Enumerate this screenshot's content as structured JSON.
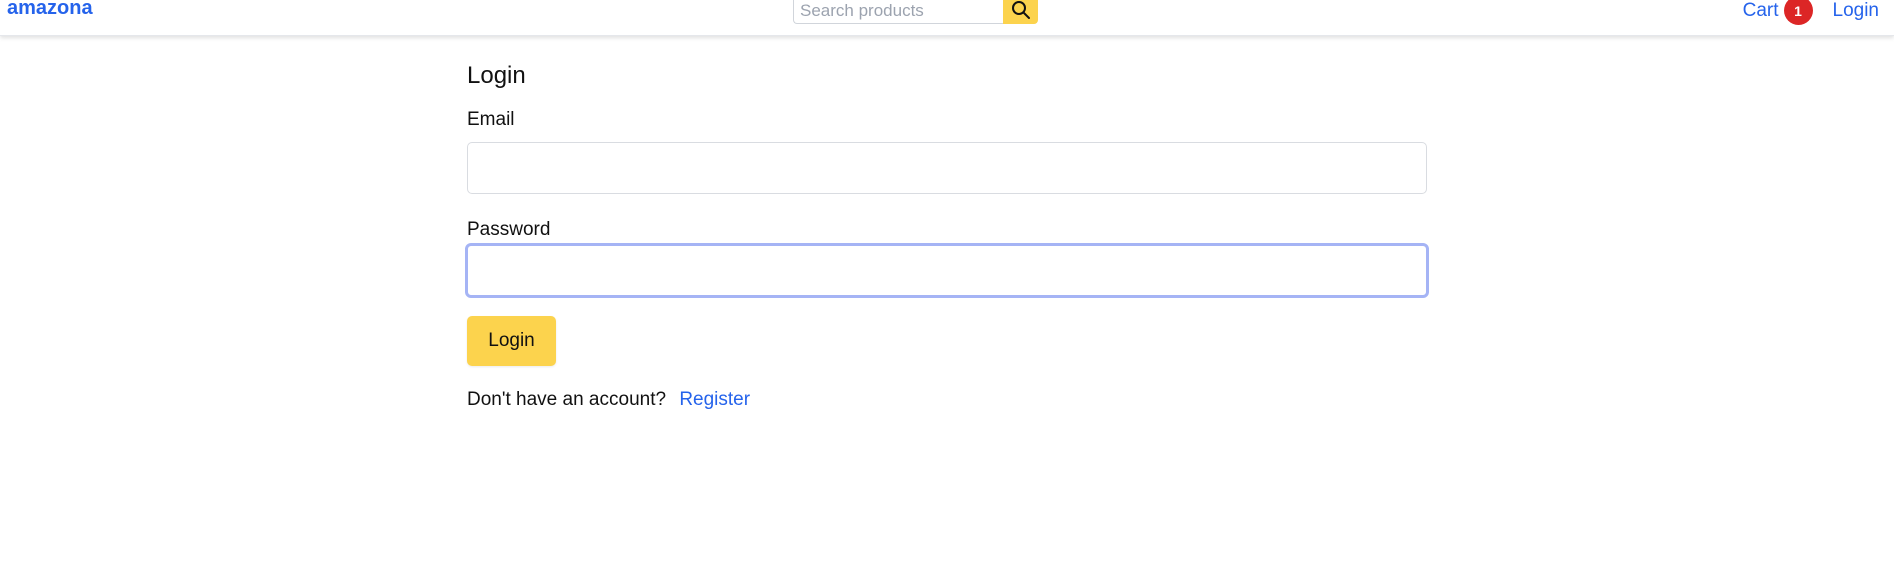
{
  "header": {
    "brand": "amazona",
    "search": {
      "placeholder": "Search products",
      "value": ""
    },
    "search_button_icon": "search-icon",
    "cart_label": "Cart",
    "cart_count": "1",
    "login_label": "Login"
  },
  "main": {
    "title": "Login",
    "email_label": "Email",
    "email_value": "",
    "password_label": "Password",
    "password_value": "",
    "submit_label": "Login",
    "register_prompt": "Don't have an account?",
    "register_link": "Register"
  },
  "colors": {
    "brand": "#2563eb",
    "accent": "#fcd34d",
    "badge": "#dc2626",
    "focus_ring": "#a5b4f5"
  }
}
